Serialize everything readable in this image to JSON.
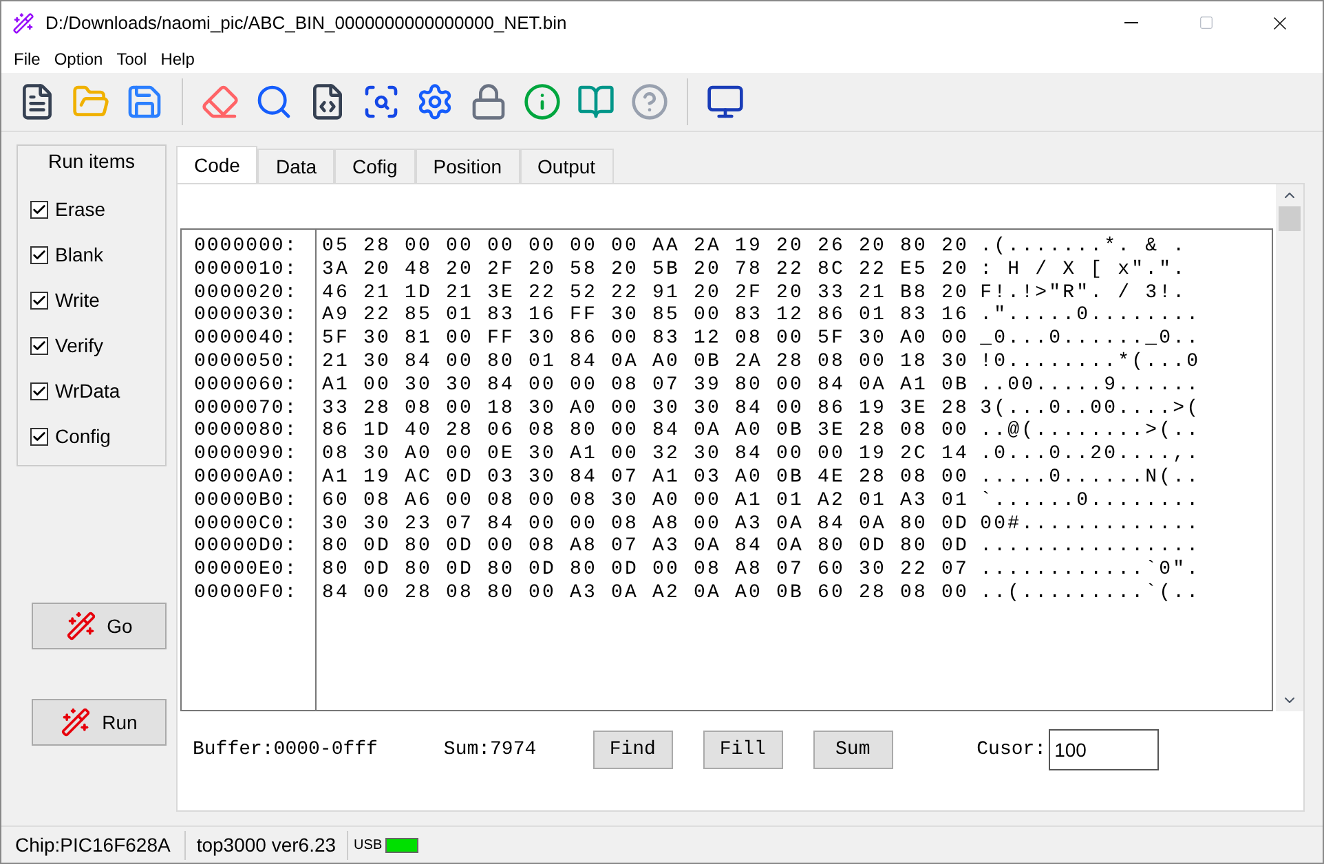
{
  "window": {
    "title": "D:/Downloads/naomi_pic/ABC_BIN_0000000000000000_NET.bin"
  },
  "menu": [
    "File",
    "Option",
    "Tool",
    "Help"
  ],
  "run_items": {
    "title": "Run items",
    "items": [
      {
        "label": "Erase",
        "checked": true
      },
      {
        "label": "Blank",
        "checked": true
      },
      {
        "label": "Write",
        "checked": true
      },
      {
        "label": "Verify",
        "checked": true
      },
      {
        "label": "WrData",
        "checked": true
      },
      {
        "label": "Config",
        "checked": true
      }
    ]
  },
  "actions": [
    "Go",
    "Run"
  ],
  "tabs": [
    {
      "label": "Code",
      "selected": true
    },
    {
      "label": "Data",
      "selected": false
    },
    {
      "label": "Cofig",
      "selected": false
    },
    {
      "label": "Position",
      "selected": false
    },
    {
      "label": "Output",
      "selected": false
    }
  ],
  "hex_rows": [
    {
      "address": "0000000:",
      "bytes": "05 28 00 00 00 00 00 00 AA 2A 19 20 26 20 80 20",
      "ascii": ".(.......*. & ."
    },
    {
      "address": "0000010:",
      "bytes": "3A 20 48 20 2F 20 58 20 5B 20 78 22 8C 22 E5 20",
      "ascii": ": H / X [ x\".\"."
    },
    {
      "address": "0000020:",
      "bytes": "46 21 1D 21 3E 22 52 22 91 20 2F 20 33 21 B8 20",
      "ascii": "F!.!>\"R\". / 3!."
    },
    {
      "address": "0000030:",
      "bytes": "A9 22 85 01 83 16 FF 30 85 00 83 12 86 01 83 16",
      "ascii": ".\".....0........"
    },
    {
      "address": "0000040:",
      "bytes": "5F 30 81 00 FF 30 86 00 83 12 08 00 5F 30 A0 00",
      "ascii": "_0...0......_0.."
    },
    {
      "address": "0000050:",
      "bytes": "21 30 84 00 80 01 84 0A A0 0B 2A 28 08 00 18 30",
      "ascii": "!0........*(...0"
    },
    {
      "address": "0000060:",
      "bytes": "A1 00 30 30 84 00 00 08 07 39 80 00 84 0A A1 0B",
      "ascii": "..00.....9......"
    },
    {
      "address": "0000070:",
      "bytes": "33 28 08 00 18 30 A0 00 30 30 84 00 86 19 3E 28",
      "ascii": "3(...0..00....>("
    },
    {
      "address": "0000080:",
      "bytes": "86 1D 40 28 06 08 80 00 84 0A A0 0B 3E 28 08 00",
      "ascii": "..@(........>(.."
    },
    {
      "address": "0000090:",
      "bytes": "08 30 A0 00 0E 30 A1 00 32 30 84 00 00 19 2C 14",
      "ascii": ".0...0..20....,."
    },
    {
      "address": "00000A0:",
      "bytes": "A1 19 AC 0D 03 30 84 07 A1 03 A0 0B 4E 28 08 00",
      "ascii": ".....0......N(.."
    },
    {
      "address": "00000B0:",
      "bytes": "60 08 A6 00 08 00 08 30 A0 00 A1 01 A2 01 A3 01",
      "ascii": "`......0........"
    },
    {
      "address": "00000C0:",
      "bytes": "30 30 23 07 84 00 00 08 A8 00 A3 0A 84 0A 80 0D",
      "ascii": "00#............."
    },
    {
      "address": "00000D0:",
      "bytes": "80 0D 80 0D 00 08 A8 07 A3 0A 84 0A 80 0D 80 0D",
      "ascii": "................"
    },
    {
      "address": "00000E0:",
      "bytes": "80 0D 80 0D 80 0D 80 0D 00 08 A8 07 60 30 22 07",
      "ascii": "............`0\"."
    },
    {
      "address": "00000F0:",
      "bytes": "84 00 28 08 80 00 A3 0A A2 0A A0 0B 60 28 08 00",
      "ascii": "..(.........`(.."
    }
  ],
  "buffer": "Buffer:0000-0fff",
  "sum": "Sum:7974",
  "buttons": [
    "Find",
    "Fill",
    "Sum"
  ],
  "cursor": {
    "label": "Cusor:",
    "value": "100"
  },
  "status_bar": {
    "chip": "Chip:PIC16F628A",
    "version": "top3000 ver6.23",
    "usb_label": "USB",
    "usb_connected": true
  }
}
